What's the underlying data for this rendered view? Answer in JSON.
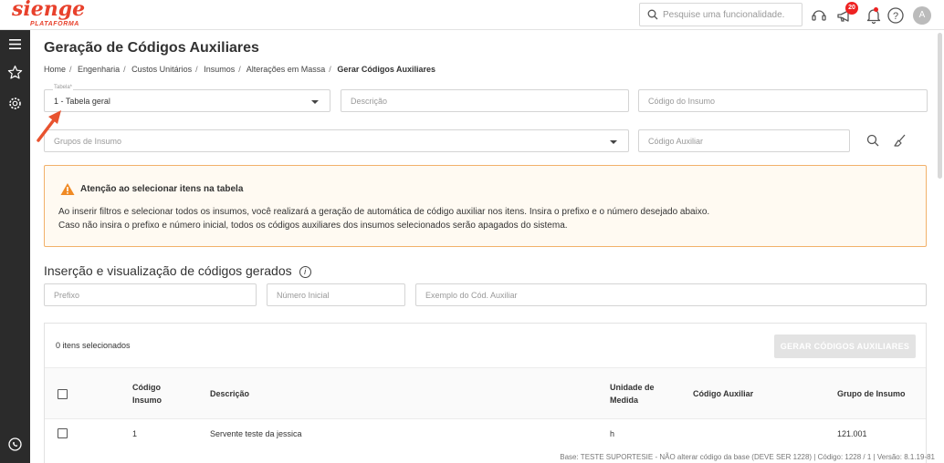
{
  "brand": {
    "name": "sienge",
    "sub": "PLATAFORMA",
    "color": "#e8412c"
  },
  "header": {
    "search_placeholder": "Pesquise uma funcionalidade.",
    "notifications_count": "20",
    "avatar_initial": "A"
  },
  "page": {
    "title": "Geração de Códigos Auxiliares",
    "breadcrumbs": [
      "Home",
      "Engenharia",
      "Custos Unitários",
      "Insumos",
      "Alterações em Massa",
      "Gerar Códigos Auxiliares"
    ]
  },
  "filters": {
    "tabela_label": "Tabela*",
    "tabela_value": "1 - Tabela geral",
    "descricao_placeholder": "Descrição",
    "codigo_insumo_placeholder": "Código do Insumo",
    "grupos_placeholder": "Grupos de Insumo",
    "codigo_auxiliar_placeholder": "Código Auxiliar"
  },
  "alert": {
    "title": "Atenção ao selecionar itens na tabela",
    "line1": "Ao inserir filtros e selecionar todos os insumos, você realizará a geração de automática de código auxiliar nos itens. Insira o prefixo e o número desejado abaixo.",
    "line2": "Caso não insira o prefixo e número inicial, todos os códigos auxiliares dos insumos selecionados serão apagados do sistema."
  },
  "section": {
    "title": "Inserção e visualização de códigos gerados",
    "info_glyph": "i",
    "prefixo_placeholder": "Prefixo",
    "numero_placeholder": "Número Inicial",
    "exemplo_placeholder": "Exemplo do Cód. Auxiliar"
  },
  "table": {
    "selected_text": "0 itens selecionados",
    "generate_label": "GERAR CÓDIGOS AUXILIARES",
    "headers": {
      "codigo1": "Código",
      "codigo2": "Insumo",
      "descricao": "Descrição",
      "unidade1": "Unidade de",
      "unidade2": "Medida",
      "aux": "Código Auxiliar",
      "grupo": "Grupo de Insumo"
    },
    "rows": [
      {
        "codigo": "1",
        "descricao": "Servente teste da jessica",
        "unidade": "h",
        "aux": "",
        "grupo": "121.001"
      }
    ]
  },
  "footer": "Base: TESTE SUPORTESIE - NÃO alterar código da base (DEVE SER 1228) | Código: 1228 / 1 | Versão: 8.1.19-81"
}
